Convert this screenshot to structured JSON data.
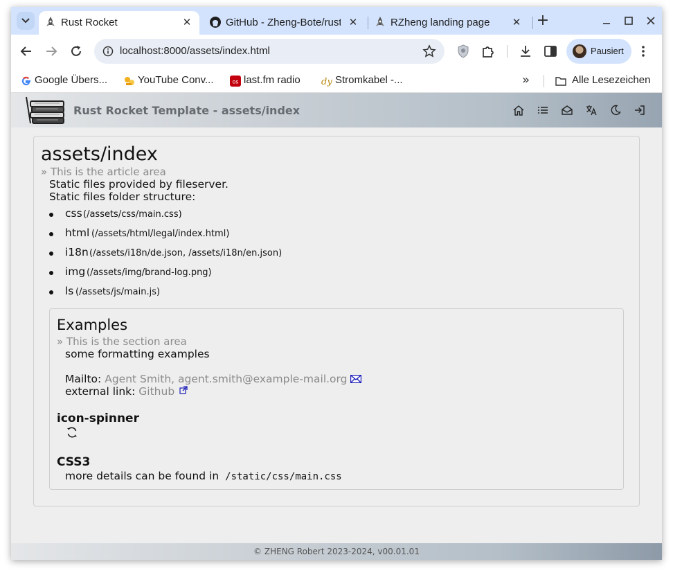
{
  "browser": {
    "tabs": [
      {
        "title": "Rust Rocket",
        "active": true
      },
      {
        "title": "GitHub - Zheng-Bote/rust",
        "active": false
      },
      {
        "title": "RZheng landing page",
        "active": false
      }
    ],
    "new_tab_symbol": "+",
    "close_symbol": "✕",
    "url": "localhost:8000/assets/index.html",
    "profile_label": "Pausiert",
    "bookmarks": [
      {
        "label": "Google Übers...",
        "icon": "google-icon"
      },
      {
        "label": "YouTube Conv...",
        "icon": "youtube-converter-icon"
      },
      {
        "label": "last.fm radio",
        "icon": "lastfm-icon"
      },
      {
        "label": "Stromkabel -...",
        "icon": "stromkabel-icon"
      }
    ],
    "bookmarks_more": "»",
    "all_bookmarks_label": "Alle Lesezeichen"
  },
  "site": {
    "title": "Rust Rocket Template - assets/index",
    "nav_icons": [
      "home-icon",
      "list-icon",
      "mail-icon",
      "translate-icon",
      "moon-icon",
      "logout-icon"
    ]
  },
  "article": {
    "heading": "assets/index",
    "subline": "» This is the article area",
    "line1": "Static files provided by fileserver.",
    "line2": "Static files folder structure:",
    "folders": [
      {
        "name": "css",
        "path": "(/assets/css/main.css)"
      },
      {
        "name": "html",
        "path": "(/assets/html/legal/index.html)"
      },
      {
        "name": "i18n",
        "path": "(/assets/i18n/de.json, /assets/i18n/en.json)"
      },
      {
        "name": "img",
        "path": "(/assets/img/brand-log.png)"
      },
      {
        "name": "ls",
        "path": "(/assets/js/main.js)"
      }
    ]
  },
  "section": {
    "heading": "Examples",
    "subline": "» This is the section area",
    "intro": "some formatting examples",
    "mailto_label": "Mailto:",
    "mailto_link": "Agent Smith, agent.smith@example-mail.org",
    "external_label": "external link:",
    "external_link": "Github",
    "spinner_heading": "icon-spinner",
    "css_heading": "CSS3",
    "css_text": "more details can be found in",
    "css_code": "/static/css/main.css"
  },
  "footer": {
    "text": "© ZHENG Robert 2023-2024, v00.01.01"
  }
}
